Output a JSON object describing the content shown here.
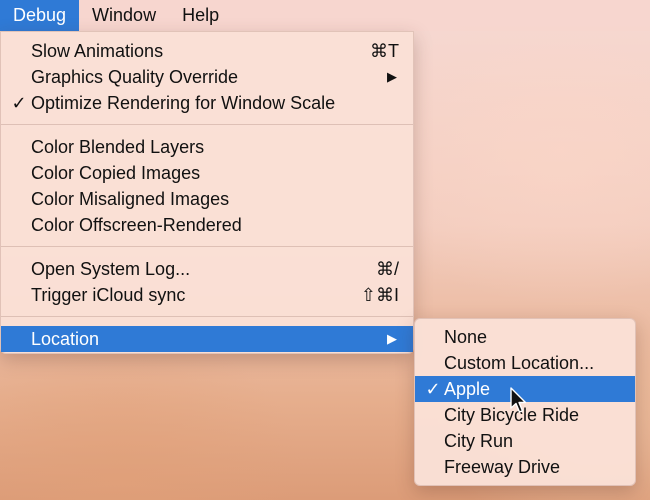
{
  "menubar": {
    "items": [
      {
        "label": "Debug"
      },
      {
        "label": "Window"
      },
      {
        "label": "Help"
      }
    ]
  },
  "debug_menu": {
    "items": [
      {
        "label": "Slow Animations",
        "shortcut": "⌘T"
      },
      {
        "label": "Graphics Quality Override",
        "submenu_arrow": "▶"
      },
      {
        "label": "Optimize Rendering for Window Scale",
        "check": "✓"
      },
      {
        "label": "Color Blended Layers"
      },
      {
        "label": "Color Copied Images"
      },
      {
        "label": "Color Misaligned Images"
      },
      {
        "label": "Color Offscreen-Rendered"
      },
      {
        "label": "Open System Log...",
        "shortcut": "⌘/"
      },
      {
        "label": "Trigger iCloud sync",
        "shortcut": "⇧⌘I"
      },
      {
        "label": "Location",
        "submenu_arrow": "▶"
      }
    ]
  },
  "location_menu": {
    "items": [
      {
        "label": "None"
      },
      {
        "label": "Custom Location..."
      },
      {
        "label": "Apple",
        "check": "✓"
      },
      {
        "label": "City Bicycle Ride"
      },
      {
        "label": "City Run"
      },
      {
        "label": "Freeway Drive"
      }
    ]
  },
  "colors": {
    "highlight": "#2f7ad6",
    "menu_background": "#fae0d6"
  }
}
